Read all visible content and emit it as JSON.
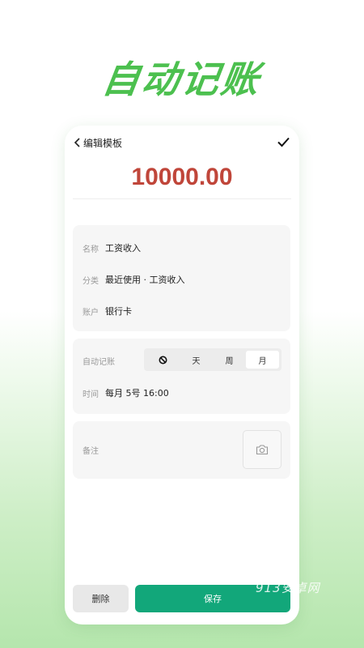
{
  "promo": {
    "title": "自动记账"
  },
  "nav": {
    "title": "编辑模板",
    "back_icon": "chevron-left-icon",
    "confirm_icon": "check-icon"
  },
  "amount": "10000.00",
  "colors": {
    "amount": "#c0463a",
    "accent": "#12a77a",
    "promo": "#4cc04f"
  },
  "details": {
    "name": {
      "label": "名称",
      "value": "工资收入"
    },
    "category": {
      "label": "分类",
      "value": "最近使用 · 工资收入"
    },
    "account": {
      "label": "账户",
      "value": "银行卡"
    }
  },
  "auto": {
    "label": "自动记账",
    "options": [
      "⊘",
      "天",
      "周",
      "月"
    ],
    "selected": "月",
    "time_label": "时间",
    "time_value": "每月 5号 16:00"
  },
  "note": {
    "label": "备注",
    "camera_icon": "camera-icon"
  },
  "actions": {
    "delete": "删除",
    "save": "保存"
  },
  "watermark": "913安卓网"
}
